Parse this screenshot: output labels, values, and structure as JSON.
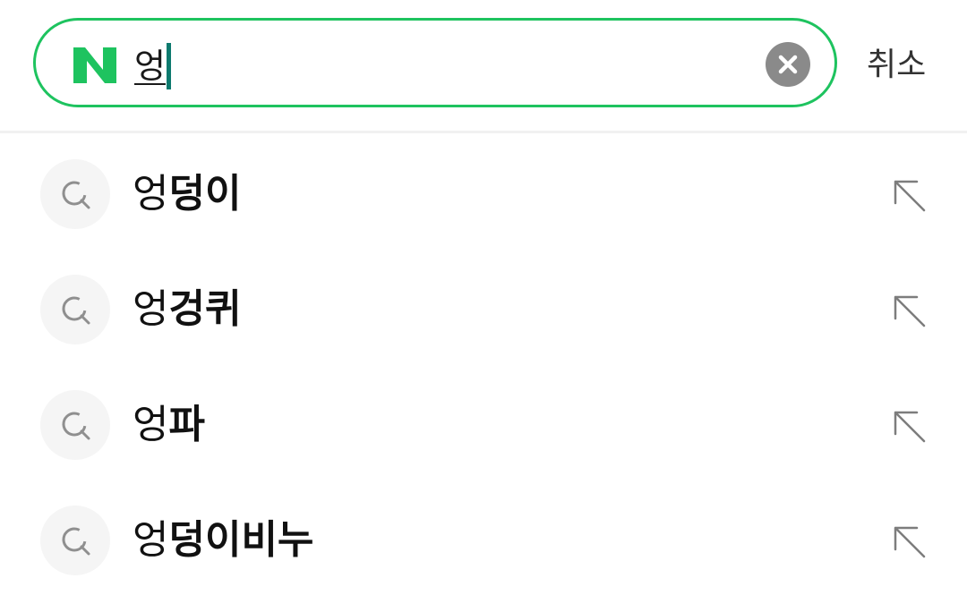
{
  "search": {
    "query": "엉",
    "logo_letter": "N",
    "cancel_label": "취소"
  },
  "colors": {
    "brand_green": "#1ec35f",
    "caret": "#0d7a6e",
    "clear_button": "#8a8a8a"
  },
  "icons": {
    "logo": "naver-n-logo",
    "clear": "clear-x-icon",
    "suggestion": "search-icon",
    "fill": "arrow-up-left-icon"
  },
  "suggestions": [
    {
      "typed": "엉",
      "rest": "덩이"
    },
    {
      "typed": "엉",
      "rest": "겅퀴"
    },
    {
      "typed": "엉",
      "rest": "파"
    },
    {
      "typed": "엉",
      "rest": "덩이비누"
    }
  ]
}
